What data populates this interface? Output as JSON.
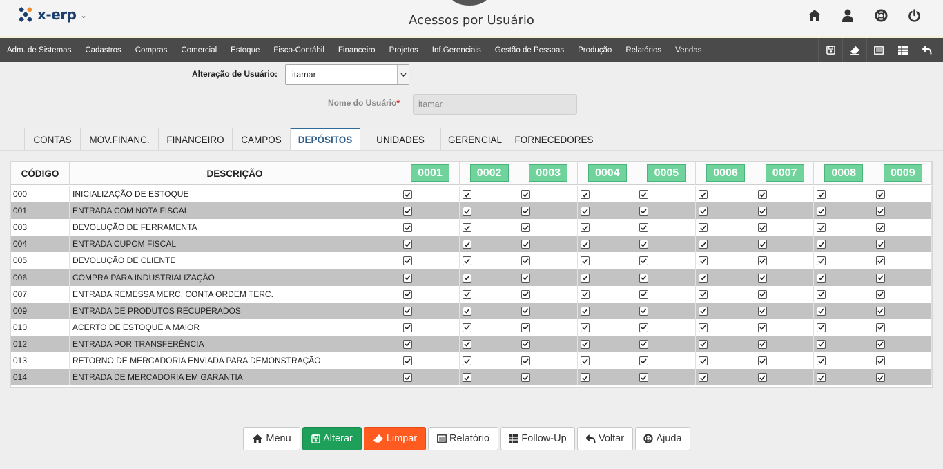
{
  "header": {
    "logo_text": "x-erp",
    "logo_caret": "⌄",
    "page_title": "Acessos por Usuário",
    "icons": [
      "home-icon",
      "user-icon",
      "lifebuoy-icon",
      "power-icon"
    ]
  },
  "menu": {
    "items": [
      "Adm. de Sistemas",
      "Cadastros",
      "Compras",
      "Comercial",
      "Estoque",
      "Fisco-Contábil",
      "Financeiro",
      "Projetos",
      "Inf.Gerenciais",
      "Gestão de Pessoas",
      "Produção",
      "Relatórios",
      "Vendas"
    ],
    "tools": [
      "save-icon",
      "eraser-icon",
      "report-icon",
      "table-icon",
      "back-icon"
    ]
  },
  "form": {
    "user_label": "Alteração de Usuário:",
    "user_value": "itamar",
    "name_label": "Nome do Usuário",
    "name_required": "*",
    "name_value": "itamar"
  },
  "tabs": [
    {
      "label": "CONTAS",
      "active": false
    },
    {
      "label": "MOV.FINANC.",
      "active": false
    },
    {
      "label": "FINANCEIRO",
      "active": false
    },
    {
      "label": "CAMPOS",
      "active": false
    },
    {
      "label": "DEPÓSITOS",
      "active": true
    },
    {
      "label": "UNIDADES",
      "active": false
    },
    {
      "label": "GERENCIAL",
      "active": false
    },
    {
      "label": "FORNECEDORES",
      "active": false
    }
  ],
  "table": {
    "col_code": "CÓDIGO",
    "col_desc": "DESCRIÇÃO",
    "deposits": [
      "0001",
      "0002",
      "0003",
      "0004",
      "0005",
      "0006",
      "0007",
      "0008",
      "0009"
    ],
    "rows": [
      {
        "code": "000",
        "desc": "INICIALIZAÇÃO DE ESTOQUE"
      },
      {
        "code": "001",
        "desc": "ENTRADA COM NOTA FISCAL"
      },
      {
        "code": "003",
        "desc": "DEVOLUÇÃO DE FERRAMENTA"
      },
      {
        "code": "004",
        "desc": "ENTRADA CUPOM FISCAL"
      },
      {
        "code": "005",
        "desc": "DEVOLUÇÃO DE CLIENTE"
      },
      {
        "code": "006",
        "desc": "COMPRA PARA INDUSTRIALIZAÇÃO"
      },
      {
        "code": "007",
        "desc": "ENTRADA REMESSA MERC. CONTA ORDEM TERC."
      },
      {
        "code": "009",
        "desc": "ENTRADA DE PRODUTOS RECUPERADOS"
      },
      {
        "code": "010",
        "desc": "ACERTO DE ESTOQUE A MAIOR"
      },
      {
        "code": "012",
        "desc": "ENTRADA POR TRANSFERÊNCIA"
      },
      {
        "code": "013",
        "desc": "RETORNO DE MERCADORIA ENVIADA PARA DEMONSTRAÇÃO"
      },
      {
        "code": "014",
        "desc": "ENTRADA DE MERCADORIA EM GARANTIA"
      }
    ],
    "all_checked": true
  },
  "buttons": [
    {
      "label": "Menu",
      "icon": "home-icon",
      "style": "default"
    },
    {
      "label": "Alterar",
      "icon": "save-icon",
      "style": "green"
    },
    {
      "label": "Limpar",
      "icon": "eraser-icon",
      "style": "orange"
    },
    {
      "label": "Relatório",
      "icon": "report-icon",
      "style": "default"
    },
    {
      "label": "Follow-Up",
      "icon": "table-icon",
      "style": "default"
    },
    {
      "label": "Voltar",
      "icon": "back-icon",
      "style": "default"
    },
    {
      "label": "Ajuda",
      "icon": "lifebuoy-icon",
      "style": "default"
    }
  ],
  "colors": {
    "menubar": "#4a4a4a",
    "deposit_badge": "#6fd39b",
    "alter_button": "#1ea05a",
    "clear_button": "#ff5a1f",
    "active_tab": "#2f5f8a"
  }
}
